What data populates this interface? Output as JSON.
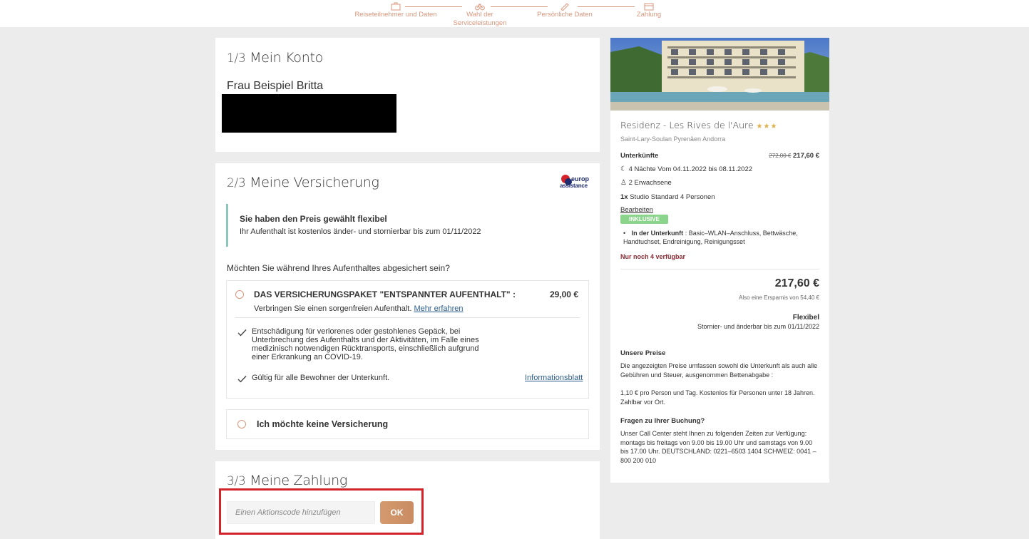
{
  "stepper": {
    "steps": [
      {
        "label": "Reiseteilnehmer und Daten",
        "icon": "suitcase-icon"
      },
      {
        "label": "Wahl der Serviceleistungen",
        "icon": "bike-icon"
      },
      {
        "label": "Persönliche Daten",
        "icon": "pen-icon"
      },
      {
        "label": "Zahlung",
        "icon": "credit-card-icon"
      }
    ],
    "accent_color": "#d9967c"
  },
  "account": {
    "step": "1/3",
    "title": "Mein Konto",
    "name": "Frau Beispiel Britta"
  },
  "insurance": {
    "step": "2/3",
    "title": "Meine Versicherung",
    "logo": {
      "line1": "europ",
      "line2": "assistance"
    },
    "info_title": "Sie haben den Preis gewählt flexibel",
    "info_text": "Ihr Aufenthalt ist kostenlos änder- und stornierbar bis zum 01/11/2022",
    "question": "Möchten Sie während Ihres Aufenthaltes abgesichert sein?",
    "package": {
      "title": "DAS VERSICHERUNGSPAKET \"ENTSPANNTER AUFENTHALT\" :",
      "price": "29,00 €",
      "subtitle": "Verbringen Sie einen sorgenfreien Aufenthalt.",
      "more_link": "Mehr erfahren",
      "benefits": [
        "Entschädigung für verlorenes oder gestohlenes Gepäck, bei Unterbrechung des Aufenthalts und der Aktivitäten, im Falle eines medizinisch notwendigen Rücktransports, einschließlich aufgrund einer Erkrankung an COVID-19.",
        "Gültig für alle Bewohner der Unterkunft."
      ],
      "info_sheet_link": "Informationsblatt"
    },
    "no_insurance_label": "Ich möchte keine Versicherung"
  },
  "payment": {
    "step": "3/3",
    "title": "Meine Zahlung",
    "promo_placeholder": "Einen Aktionscode hinzufügen",
    "ok_label": "OK"
  },
  "sidebar": {
    "hotel_name": "Residenz - Les Rives de l'Aure",
    "stars": "★★★",
    "location": "Saint-Lary-Soulan Pyrenäen Andorra",
    "accommodations_label": "Unterkünfte",
    "old_price": "272,00 €",
    "new_price": "217,60 €",
    "nights": "4 Nächte Vom 04.11.2022 bis 08.11.2022",
    "guests": "2 Erwachsene",
    "room_qty": "1x",
    "room": "Studio Standard 4 Personen",
    "edit_link": "Bearbeiten",
    "inclusive_badge": "INKLUSIVE",
    "included_label": "In der Unterkunft",
    "included_items": "Basic–WLAN–Anschluss, Bettwäsche, Handtuchset, Endreinigung, Reinigungsset",
    "availability": "Nur noch 4 verfügbar",
    "total": "217,60 €",
    "savings": "Also eine Ersparnis von 54,40 €",
    "rate_name": "Flexibel",
    "rate_desc": "Stornier- und änderbar bis zum 01/11/2022",
    "prices_title": "Unsere Preise",
    "prices_text1": "Die angezeigten Preise umfassen sowohl die Unterkunft als auch alle Gebühren und Steuer, ausgenommen Bettenabgabe :",
    "prices_text2": "1,10 € pro Person und Tag. Kostenlos für Personen unter 18 Jahren. Zahlbar vor Ort.",
    "questions_title": "Fragen zu Ihrer Buchung?",
    "questions_text": "Unser Call Center steht Ihnen zu folgenden Zeiten zur Verfügung: montags bis freitags von 9.00 bis 19.00 Uhr und samstags von 9.00 bis 17.00 Uhr. DEUTSCHLAND: 0221–6503 1404 SCHWEIZ: 0041 – 800 200 010"
  }
}
